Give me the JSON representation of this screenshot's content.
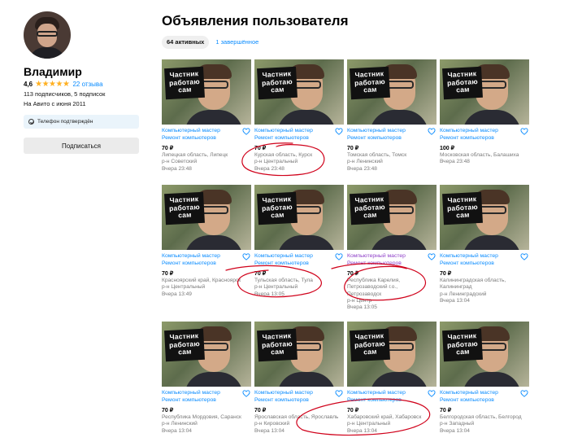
{
  "profile": {
    "name": "Владимир",
    "rating": "4,6",
    "stars": "★★★★★",
    "reviews": "22 отзыва",
    "followers": "113 подписчиков, 5 подписок",
    "since": "На Авито с июня 2011",
    "phone_status": "Телефон подтверждён",
    "subscribe_label": "Подписаться"
  },
  "page": {
    "title": "Объявления пользователя",
    "tab_active": "64 активных",
    "tab_done": "1 завершённое"
  },
  "card_sign": [
    "Частник",
    "работаю",
    "сам"
  ],
  "colors": {
    "accent": "#0a8cff",
    "visited": "#8e3fc8",
    "annotation": "#d0021b"
  },
  "listings": [
    {
      "title": [
        "Компьютерный мастер",
        "Ремонт компьютеров"
      ],
      "price": "70 ₽",
      "location": [
        "Липецкая область, Липецк",
        "р-н Советский",
        "Вчера 23:48"
      ]
    },
    {
      "title": [
        "Компьютерный мастер",
        "Ремонт компьютеров"
      ],
      "price": "70 ₽",
      "location": [
        "Курская область, Курск",
        "р-н Центральный",
        "Вчера 23:48"
      ]
    },
    {
      "title": [
        "Компьютерный мастер",
        "Ремонт компьютеров"
      ],
      "price": "70 ₽",
      "location": [
        "Томская область, Томск",
        "р-н Ленинский",
        "Вчера 23:48"
      ]
    },
    {
      "title": [
        "Компьютерный мастер",
        "Ремонт компьютеров"
      ],
      "price": "100 ₽",
      "location": [
        "Московская область, Балашиха",
        "Вчера 23:48"
      ]
    },
    {
      "title": [
        "Компьютерный мастер",
        "Ремонт компьютеров"
      ],
      "price": "70 ₽",
      "location": [
        "Красноярский край, Красноярск",
        "р-н Центральный",
        "Вчера 13:49"
      ]
    },
    {
      "title": [
        "Компьютерный мастер",
        "Ремонт компьютеров"
      ],
      "price": "70 ₽",
      "location": [
        "Тульская область, Тула",
        "р-н Центральный",
        "Вчера 13:05"
      ]
    },
    {
      "title": [
        "Компьютерный мастер",
        "Ремонт компьютеров"
      ],
      "price": "70 ₽",
      "location": [
        "Республика Карелия,",
        "Петрозаводский г.о.,",
        "Петрозаводск",
        "р-н Центр",
        "Вчера 13:05"
      ],
      "visited": true
    },
    {
      "title": [
        "Компьютерный мастер",
        "Ремонт компьютеров"
      ],
      "price": "70 ₽",
      "location": [
        "Калининградская область,",
        "Калининград",
        "р-н Ленинградский",
        "Вчера 13:04"
      ]
    },
    {
      "title": [
        "Компьютерный мастер",
        "Ремонт компьютеров"
      ],
      "price": "70 ₽",
      "location": [
        "Республика Мордовия, Саранск",
        "р-н Ленинский",
        "Вчера 13:04"
      ]
    },
    {
      "title": [
        "Компьютерный мастер",
        "Ремонт компьютеров"
      ],
      "price": "70 ₽",
      "location": [
        "Ярославская область, Ярославль",
        "р-н Кировский",
        "Вчера 13:04"
      ]
    },
    {
      "title": [
        "Компьютерный мастер",
        "Ремонт компьютеров"
      ],
      "price": "70 ₽",
      "location": [
        "Хабаровский край, Хабаровск",
        "р-н Центральный",
        "Вчера 13:04"
      ]
    },
    {
      "title": [
        "Компьютерный мастер",
        "Ремонт компьютеров"
      ],
      "price": "70 ₽",
      "location": [
        "Белгородская область, Белгород",
        "р-н Западный",
        "Вчера 13:04"
      ]
    }
  ]
}
